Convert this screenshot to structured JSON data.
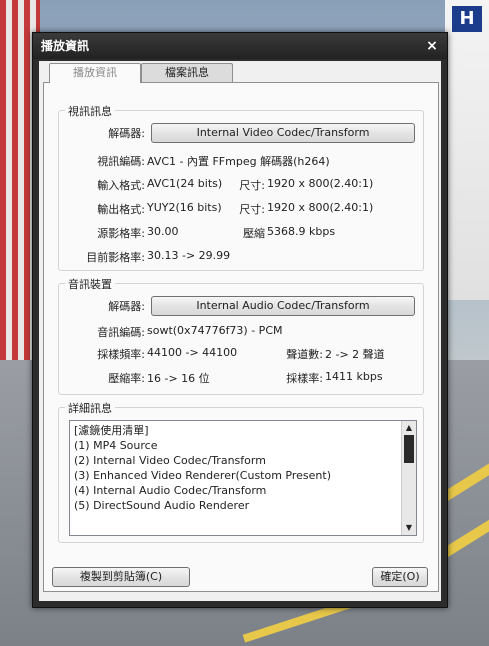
{
  "window": {
    "title": "播放資訊",
    "close_glyph": "×"
  },
  "tabs": [
    {
      "label": "播放資訊",
      "active": true
    },
    {
      "label": "檔案訊息",
      "active": false
    }
  ],
  "video": {
    "group_title": "視訊訊息",
    "decoder_label": "解碼器:",
    "decoder_value": "Internal Video Codec/Transform",
    "codec_label": "視訊編碼:",
    "codec_value": "AVC1 - 內置 FFmpeg 解碼器(h264)",
    "input_label": "輸入格式:",
    "input_value": "AVC1(24 bits)",
    "input_size_label": "尺寸:",
    "input_size_value": "1920 x 800(2.40:1)",
    "output_label": "輸出格式:",
    "output_value": "YUY2(16 bits)",
    "output_size_label": "尺寸:",
    "output_size_value": "1920 x 800(2.40:1)",
    "src_fps_label": "源影格率:",
    "src_fps_value": "30.00",
    "compress_label": "壓縮",
    "compress_value": "5368.9 kbps",
    "cur_fps_label": "目前影格率:",
    "cur_fps_value": "30.13 -> 29.99"
  },
  "audio": {
    "group_title": "音訊裝置",
    "decoder_label": "解碼器:",
    "decoder_value": "Internal Audio Codec/Transform",
    "codec_label": "音訊編碼:",
    "codec_value": "sowt(0x74776f73) - PCM",
    "sample_label": "採樣頻率:",
    "sample_value": "44100 -> 44100",
    "channels_label": "聲道數:",
    "channels_value": "2 -> 2 聲道",
    "bits_label": "壓縮率:",
    "bits_value": "16 -> 16 位",
    "bitrate_label": "採樣率:",
    "bitrate_value": "1411 kbps"
  },
  "details": {
    "group_title": "詳細訊息",
    "items": [
      "[濾鏡使用清單]",
      "(1) MP4 Source",
      "(2) Internal Video Codec/Transform",
      "(3) Enhanced Video Renderer(Custom Present)",
      "(4) Internal Audio Codec/Transform",
      "(5) DirectSound Audio Renderer"
    ]
  },
  "buttons": {
    "copy": "複製到剪貼簿(C)",
    "ok": "確定(O)"
  },
  "background": {
    "sign": "H"
  }
}
